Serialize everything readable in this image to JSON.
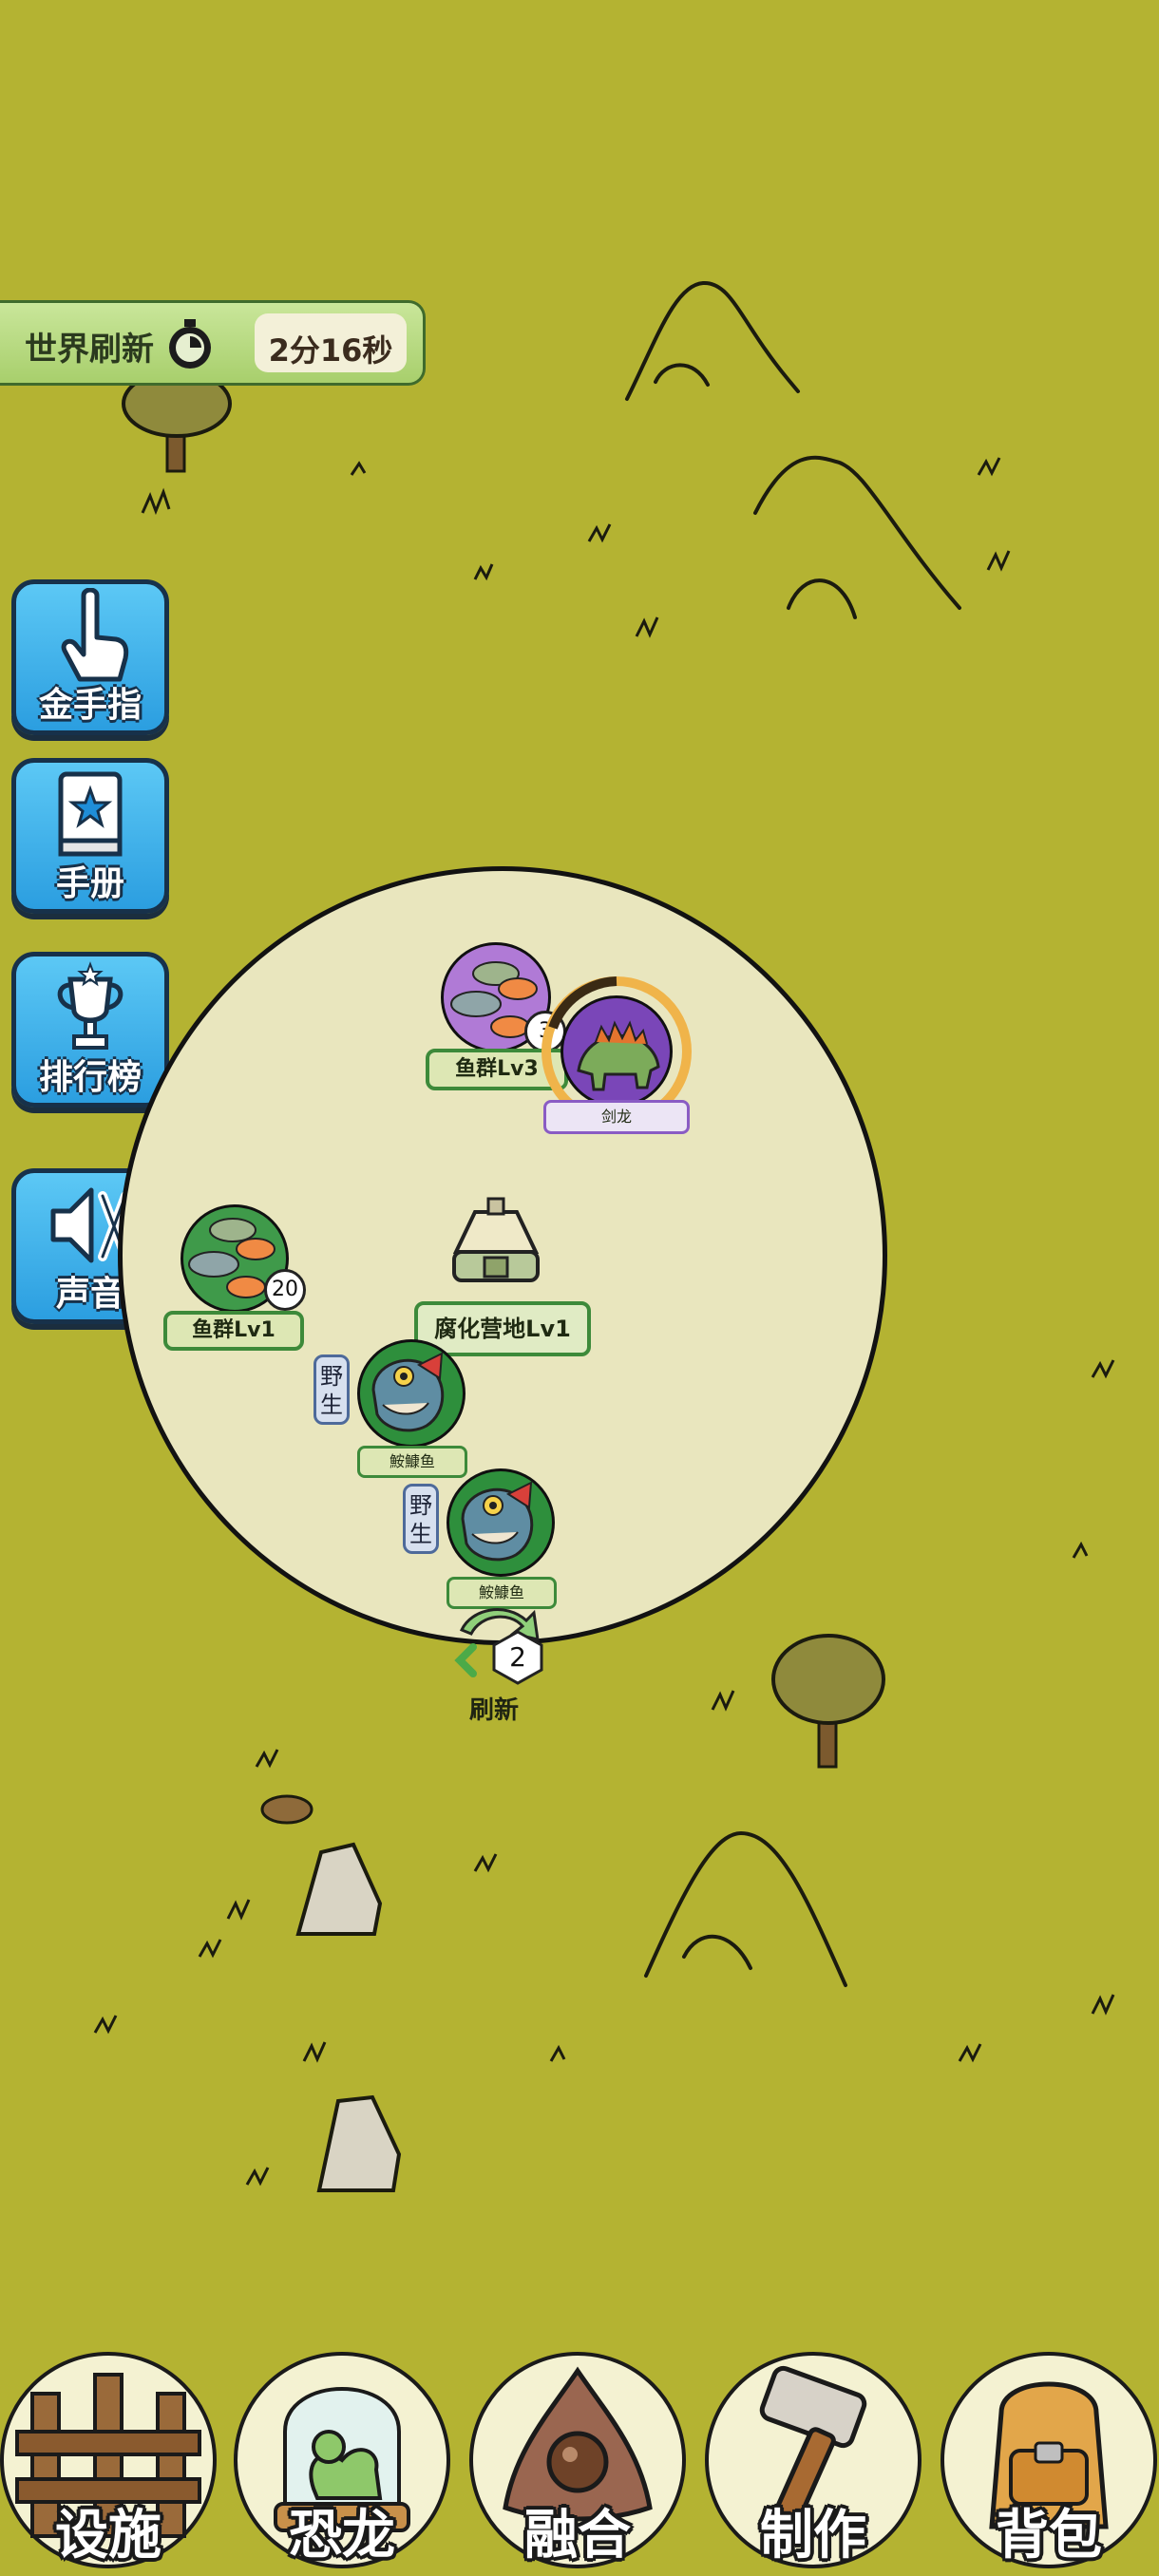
{
  "world_refresh": {
    "label": "世界刷新",
    "timer": "2分16秒"
  },
  "side_menu": [
    {
      "id": "cheat",
      "label": "金手指",
      "icon": "pointing-hand-icon"
    },
    {
      "id": "manual",
      "label": "手册",
      "icon": "star-book-icon"
    },
    {
      "id": "ranking",
      "label": "排行榜",
      "icon": "trophy-icon"
    },
    {
      "id": "sound",
      "label": "声音",
      "icon": "speaker-muted-icon"
    }
  ],
  "camp": {
    "center": {
      "label": "腐化营地Lv1",
      "icon": "camp-tent-icon"
    },
    "entities": [
      {
        "id": "fish-school-lv3",
        "label": "鱼群Lv3",
        "count": "3",
        "icon": "fish-school-icon"
      },
      {
        "id": "stegosaurus",
        "label": "剑龙",
        "icon": "stegosaurus-icon"
      },
      {
        "id": "fish-school-lv1",
        "label": "鱼群Lv1",
        "count": "20",
        "icon": "fish-school-icon"
      },
      {
        "id": "catfish-1",
        "label": "鮟鱇鱼",
        "status": "野生",
        "icon": "catfish-icon"
      },
      {
        "id": "catfish-2",
        "label": "鮟鱇鱼",
        "status": "野生",
        "icon": "catfish-icon"
      }
    ],
    "refresh": {
      "label": "刷新",
      "count": "2",
      "icon": "refresh-arrow-icon"
    }
  },
  "bottom_nav": [
    {
      "id": "facilities",
      "label": "设施",
      "icon": "wooden-fence-icon"
    },
    {
      "id": "dinosaur",
      "label": "恐龙",
      "icon": "dino-terrarium-icon"
    },
    {
      "id": "fusion",
      "label": "融合",
      "icon": "fusion-triangle-icon"
    },
    {
      "id": "craft",
      "label": "制作",
      "icon": "hammer-icon"
    },
    {
      "id": "backpack",
      "label": "背包",
      "icon": "backpack-icon"
    }
  ],
  "colors": {
    "grass": "#b4b332",
    "camp_ground": "#e9e6be",
    "side_button": "#3aa8e6",
    "label_border_green": "#3d8a3a",
    "timer_ring": "#f0b44a"
  }
}
